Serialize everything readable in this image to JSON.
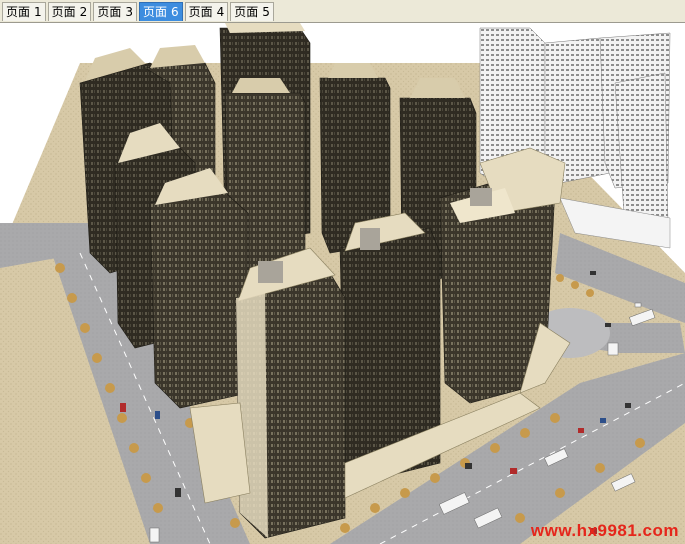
{
  "tabs": [
    {
      "label": "页面",
      "num": "1",
      "active": false
    },
    {
      "label": "页面",
      "num": "2",
      "active": false
    },
    {
      "label": "页面",
      "num": "3",
      "active": false
    },
    {
      "label": "页面",
      "num": "6",
      "active": true
    },
    {
      "label": "页面",
      "num": "4",
      "active": false
    },
    {
      "label": "页面",
      "num": "5",
      "active": false
    }
  ],
  "scene": {
    "subject": "residential-high-rise-complex-3d-model",
    "colors": {
      "ground": "#d7c9a7",
      "road": "#a9a9ab",
      "tower_dark": "#2f2b22",
      "tower_cream": "#e6dcc0",
      "tower_white": "#f4f4f4",
      "tree": "#c79a4c"
    }
  },
  "watermark": "www.hx9981.com"
}
